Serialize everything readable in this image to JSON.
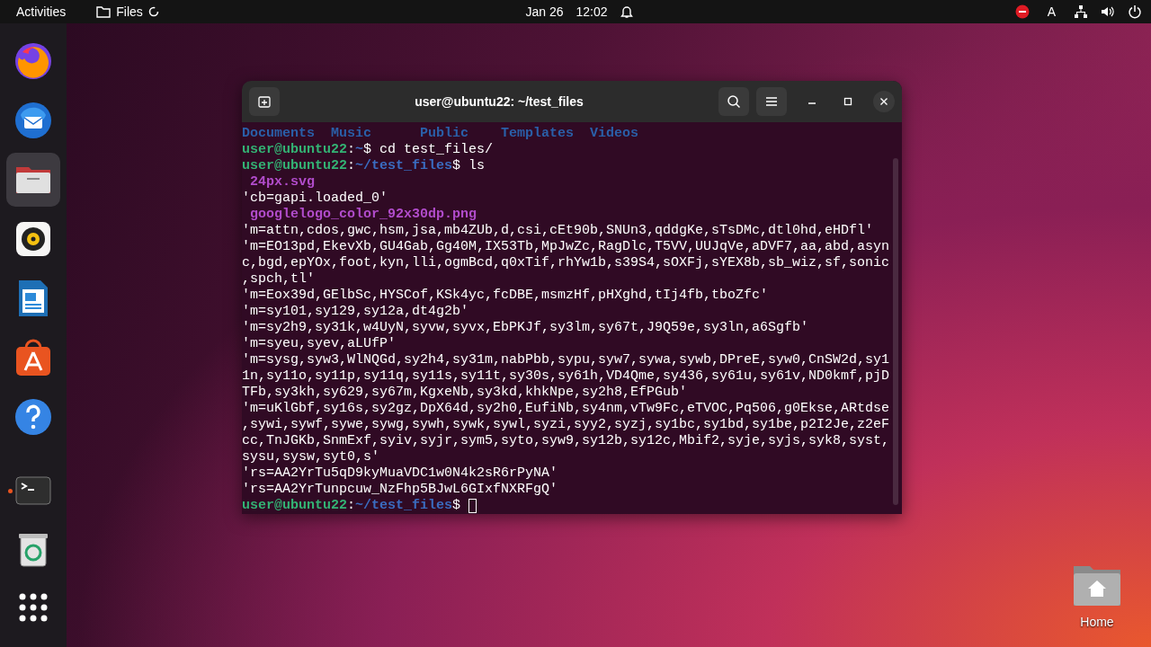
{
  "top_bar": {
    "activities": "Activities",
    "app": "Files",
    "date": "Jan 26",
    "time": "12:02",
    "keyboard": "A"
  },
  "dock": {
    "pinned": [
      {
        "kind": "firefox",
        "active": false,
        "running": false
      },
      {
        "kind": "thunderbird",
        "active": false,
        "running": false
      },
      {
        "kind": "files",
        "active": true,
        "running": false
      },
      {
        "kind": "rhythmbox",
        "active": false,
        "running": false
      },
      {
        "kind": "writer",
        "active": false,
        "running": false
      },
      {
        "kind": "appcenter",
        "active": false,
        "running": false
      },
      {
        "kind": "help",
        "active": false,
        "running": false
      }
    ],
    "other": [
      {
        "kind": "terminal",
        "active": false,
        "running": true
      },
      {
        "kind": "trash",
        "active": false,
        "running": false
      }
    ],
    "show_apps": {
      "kind": "grid"
    }
  },
  "terminal": {
    "title": "user@ubuntu22: ~/test_files",
    "lines": [
      {
        "kind": "dirs",
        "text": "Documents  Music      Public    Templates  Videos"
      },
      {
        "kind": "prompt",
        "user": "user@ubuntu22",
        "sep": ":",
        "path": "~",
        "command": "$ cd test_files/",
        "cursor": false
      },
      {
        "kind": "prompt",
        "user": "user@ubuntu22",
        "sep": ":",
        "path": "~/test_files",
        "command": "$ ls",
        "cursor": false
      },
      {
        "kind": "image",
        "text": " 24px.svg"
      },
      {
        "kind": "plain",
        "text": "'cb=gapi.loaded_0'"
      },
      {
        "kind": "image",
        "text": " googlelogo_color_92x30dp.png"
      },
      {
        "kind": "plain",
        "text": "'m=attn,cdos,gwc,hsm,jsa,mb4ZUb,d,csi,cEt90b,SNUn3,qddgKe,sTsDMc,dtl0hd,eHDfl'"
      },
      {
        "kind": "plain",
        "text": "'m=EO13pd,EkevXb,GU4Gab,Gg40M,IX53Tb,MpJwZc,RagDlc,T5VV,UUJqVe,aDVF7,aa,abd,asyn"
      },
      {
        "kind": "plain",
        "text": "c,bgd,epYOx,foot,kyn,lli,ogmBcd,q0xTif,rhYw1b,s39S4,sOXFj,sYEX8b,sb_wiz,sf,sonic"
      },
      {
        "kind": "plain",
        "text": ",spch,tl'"
      },
      {
        "kind": "plain",
        "text": "'m=Eox39d,GElbSc,HYSCof,KSk4yc,fcDBE,msmzHf,pHXghd,tIj4fb,tboZfc'"
      },
      {
        "kind": "plain",
        "text": "'m=sy101,sy129,sy12a,dt4g2b'"
      },
      {
        "kind": "plain",
        "text": "'m=sy2h9,sy31k,w4UyN,syvw,syvx,EbPKJf,sy3lm,sy67t,J9Q59e,sy3ln,a6Sgfb'"
      },
      {
        "kind": "plain",
        "text": "'m=syeu,syev,aLUfP'"
      },
      {
        "kind": "plain",
        "text": "'m=sysg,syw3,WlNQGd,sy2h4,sy31m,nabPbb,sypu,syw7,sywa,sywb,DPreE,syw0,CnSW2d,sy1"
      },
      {
        "kind": "plain",
        "text": "1n,sy11o,sy11p,sy11q,sy11s,sy11t,sy30s,sy61h,VD4Qme,sy436,sy61u,sy61v,ND0kmf,pjD"
      },
      {
        "kind": "plain",
        "text": "TFb,sy3kh,sy629,sy67m,KgxeNb,sy3kd,khkNpe,sy2h8,EfPGub'"
      },
      {
        "kind": "plain",
        "text": "'m=uKlGbf,sy16s,sy2gz,DpX64d,sy2h0,EufiNb,sy4nm,vTw9Fc,eTVOC,Pq506,g0Ekse,ARtdse"
      },
      {
        "kind": "plain",
        "text": ",sywi,sywf,sywe,sywg,sywh,sywk,sywl,syzi,syy2,syzj,sy1bc,sy1bd,sy1be,p2I2Je,z2eF"
      },
      {
        "kind": "plain",
        "text": "cc,TnJGKb,SnmExf,syiv,syjr,sym5,syto,syw9,sy12b,sy12c,Mbif2,syje,syjs,syk8,syst,"
      },
      {
        "kind": "plain",
        "text": "sysu,sysw,syt0,s'"
      },
      {
        "kind": "plain",
        "text": "'rs=AA2YrTu5qD9kyMuaVDC1w0N4k2sR6rPyNA'"
      },
      {
        "kind": "plain",
        "text": "'rs=AA2YrTunpcuw_NzFhp5BJwL6GIxfNXRFgQ'"
      },
      {
        "kind": "prompt",
        "user": "user@ubuntu22",
        "sep": ":",
        "path": "~/test_files",
        "command": "$ ",
        "cursor": true
      }
    ]
  },
  "desktop": {
    "icons": [
      {
        "label": "Home"
      }
    ]
  }
}
